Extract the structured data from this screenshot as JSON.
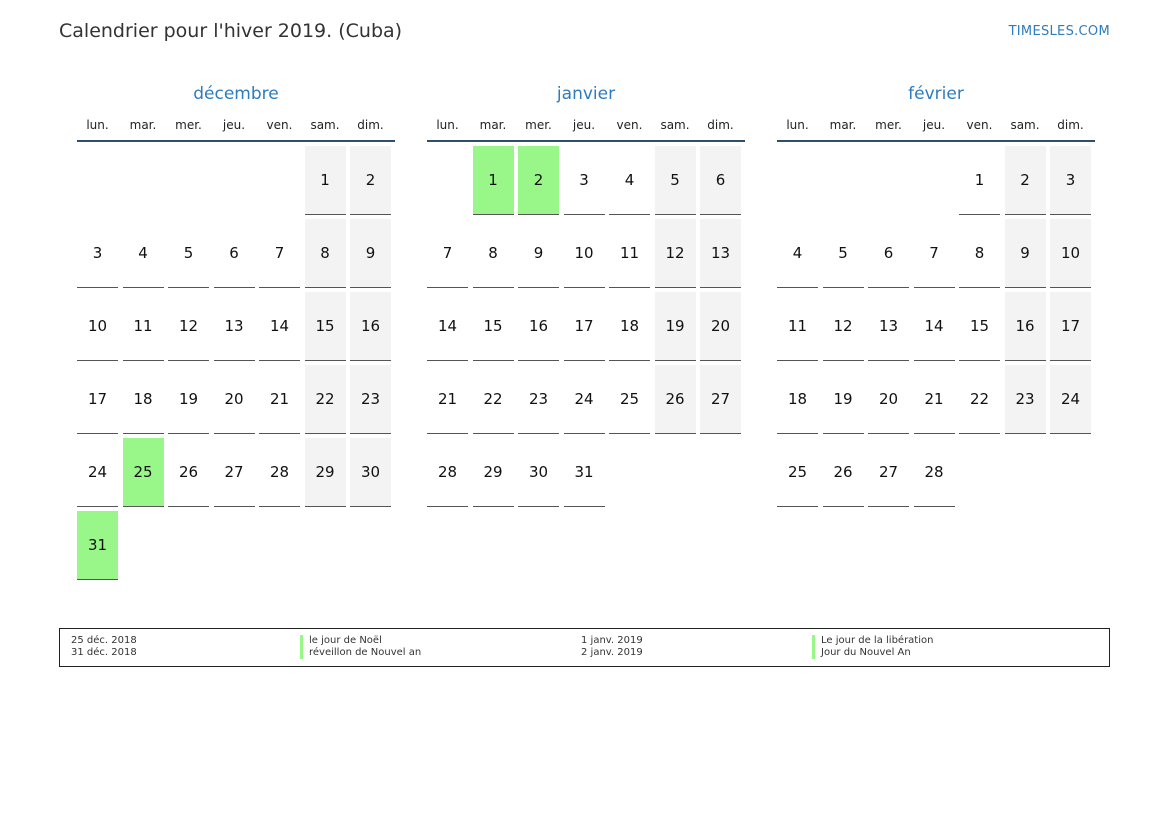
{
  "header": {
    "title": "Calendrier pour l'hiver 2019. (Cuba)",
    "brand": "TIMESLES.COM"
  },
  "weekdays": [
    "lun.",
    "mar.",
    "mer.",
    "jeu.",
    "ven.",
    "sam.",
    "dim."
  ],
  "colors": {
    "holiday": "#99f78a",
    "weekend": "#f3f3f3",
    "accent": "#2e7bbf"
  },
  "months": [
    {
      "name": "décembre",
      "offset": 5,
      "days": 31,
      "holidays": [
        25,
        31
      ]
    },
    {
      "name": "janvier",
      "offset": 1,
      "days": 31,
      "holidays": [
        1,
        2
      ]
    },
    {
      "name": "février",
      "offset": 4,
      "days": 28,
      "holidays": []
    }
  ],
  "legend": [
    {
      "date": "25 déc. 2018",
      "name": "le jour de Noël"
    },
    {
      "date": "31 déc. 2018",
      "name": "réveillon de Nouvel an"
    },
    {
      "date": "1 janv. 2019",
      "name": "Le jour de la libération"
    },
    {
      "date": "2 janv. 2019",
      "name": "Jour du Nouvel An"
    }
  ]
}
